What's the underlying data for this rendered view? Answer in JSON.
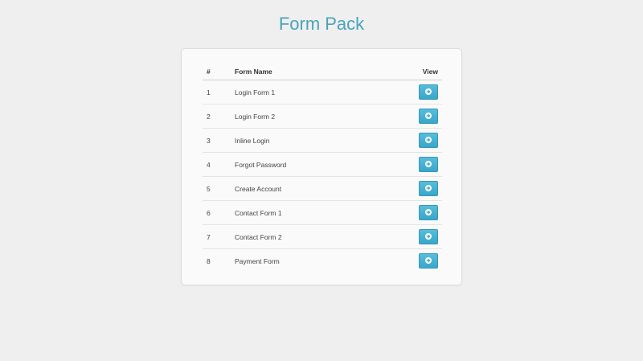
{
  "page": {
    "title": "Form Pack"
  },
  "table": {
    "headers": {
      "num": "#",
      "name": "Form Name",
      "view": "View"
    },
    "rows": [
      {
        "num": "1",
        "name": "Login Form 1"
      },
      {
        "num": "2",
        "name": "Login Form 2"
      },
      {
        "num": "3",
        "name": "Inline Login"
      },
      {
        "num": "4",
        "name": "Forgot Password"
      },
      {
        "num": "5",
        "name": "Create Account"
      },
      {
        "num": "6",
        "name": "Contact Form 1"
      },
      {
        "num": "7",
        "name": "Contact Form 2"
      },
      {
        "num": "8",
        "name": "Payment Form"
      }
    ],
    "view_button_icon": "arrow-right-circle-icon"
  },
  "colors": {
    "title": "#4aa3b9",
    "button": "#45b0d1",
    "background": "#efefef"
  }
}
